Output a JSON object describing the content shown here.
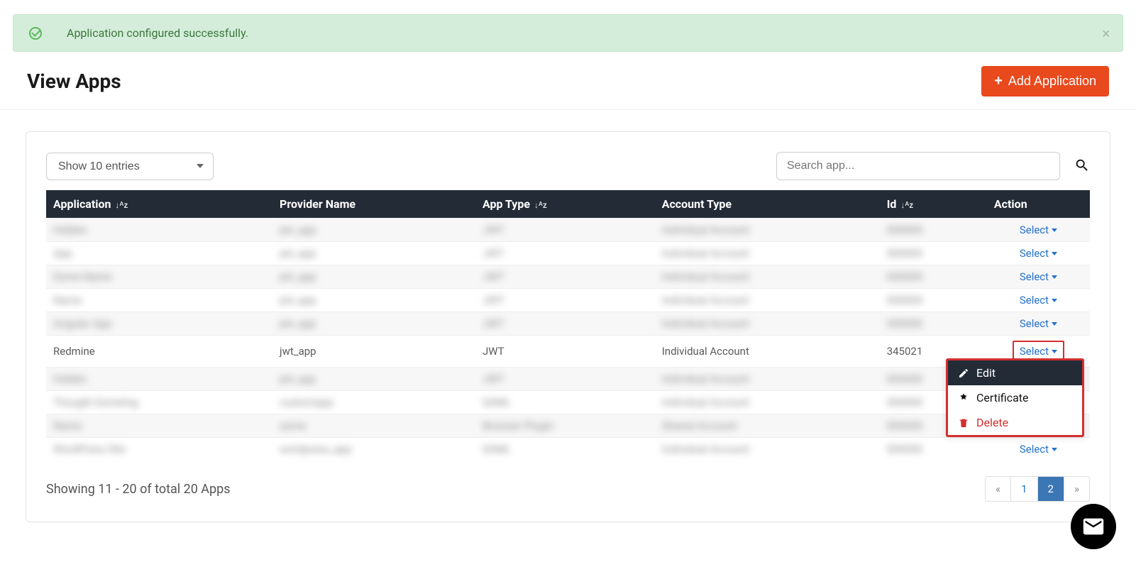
{
  "alert": {
    "message": "Application configured successfully."
  },
  "page_title": "View Apps",
  "add_button": "Add Application",
  "entries_select": "Show 10 entries",
  "search": {
    "placeholder": "Search app..."
  },
  "columns": {
    "app": "Application",
    "provider": "Provider Name",
    "apptype": "App Type",
    "account": "Account Type",
    "id": "Id",
    "action": "Action"
  },
  "select_label": "Select",
  "rows": [
    {
      "blurred": true,
      "app": "Hidden",
      "provider": "jwt_app",
      "type": "JWT",
      "account": "Individual Account",
      "id": "000000"
    },
    {
      "blurred": true,
      "app": "App",
      "provider": "jwt_app",
      "type": "JWT",
      "account": "Individual Account",
      "id": "000000"
    },
    {
      "blurred": true,
      "app": "Some Name",
      "provider": "jwt_app",
      "type": "JWT",
      "account": "Individual Account",
      "id": "000000"
    },
    {
      "blurred": true,
      "app": "Name",
      "provider": "jwt_app",
      "type": "JWT",
      "account": "Individual Account",
      "id": "000000"
    },
    {
      "blurred": true,
      "app": "Angular App",
      "provider": "jwt_app",
      "type": "JWT",
      "account": "Individual Account",
      "id": "000000"
    },
    {
      "blurred": false,
      "app": "Redmine",
      "provider": "jwt_app",
      "type": "JWT",
      "account": "Individual Account",
      "id": "345021",
      "dropdown_open": true
    },
    {
      "blurred": true,
      "app": "Hidden",
      "provider": "jwt_app",
      "type": "JWT",
      "account": "Individual Account",
      "id": "000000"
    },
    {
      "blurred": true,
      "app": "Thought Sometng",
      "provider": "customapp",
      "type": "SAML",
      "account": "Individual Account",
      "id": "000000"
    },
    {
      "blurred": true,
      "app": "Name",
      "provider": "some",
      "type": "Browser Plugin",
      "account": "Shared Account",
      "id": "000000"
    },
    {
      "blurred": true,
      "app": "WordPress Site",
      "provider": "wordpress_app",
      "type": "SAML",
      "account": "Individual Account",
      "id": "000000"
    }
  ],
  "dropdown": {
    "edit": "Edit",
    "certificate": "Certificate",
    "delete": "Delete"
  },
  "showing_text": "Showing 11 - 20 of total 20 Apps",
  "pagination": {
    "prev": "«",
    "p1": "1",
    "p2": "2",
    "next": "»"
  }
}
